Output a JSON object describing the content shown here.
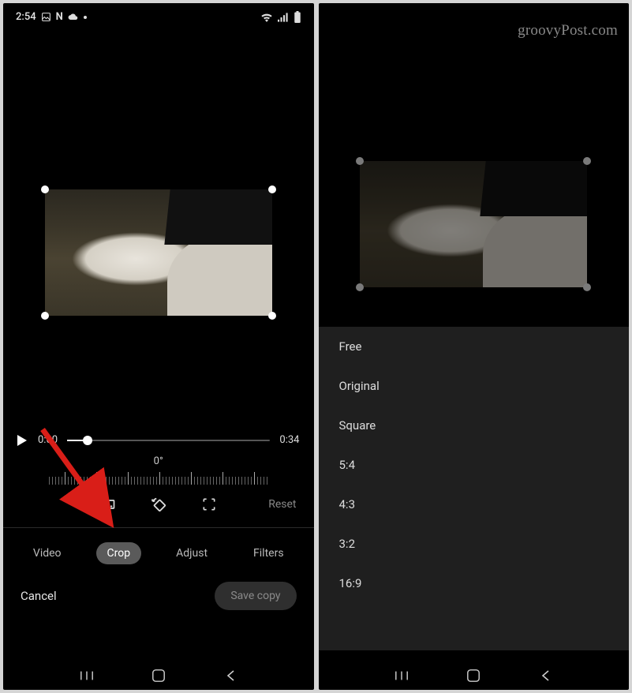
{
  "watermark": "groovyPost.com",
  "status": {
    "time": "2:54",
    "icons_left": [
      "image-icon",
      "netflix-icon",
      "cloud-icon",
      "dot-icon"
    ],
    "icons_right": [
      "wifi-icon",
      "signal-icon",
      "battery-icon"
    ]
  },
  "timeline": {
    "current": "0:00",
    "duration": "0:34",
    "progress_percent": 10
  },
  "rotation": {
    "angle_label": "0°"
  },
  "crop_tools": {
    "aspect_ratio": "aspect-ratio-icon",
    "rotate": "rotate-icon",
    "free_transform": "free-transform-icon",
    "reset_label": "Reset"
  },
  "tabs": {
    "items": [
      {
        "label": "Video",
        "active": false
      },
      {
        "label": "Crop",
        "active": true
      },
      {
        "label": "Adjust",
        "active": false
      },
      {
        "label": "Filters",
        "active": false
      }
    ]
  },
  "actions": {
    "cancel": "Cancel",
    "save": "Save copy"
  },
  "aspect_ratios": [
    "Free",
    "Original",
    "Square",
    "5:4",
    "4:3",
    "3:2",
    "16:9"
  ],
  "colors": {
    "arrow": "#d91e18",
    "panel_bg": "#1f1f1f",
    "active_tab_bg": "#5a5a5a"
  }
}
